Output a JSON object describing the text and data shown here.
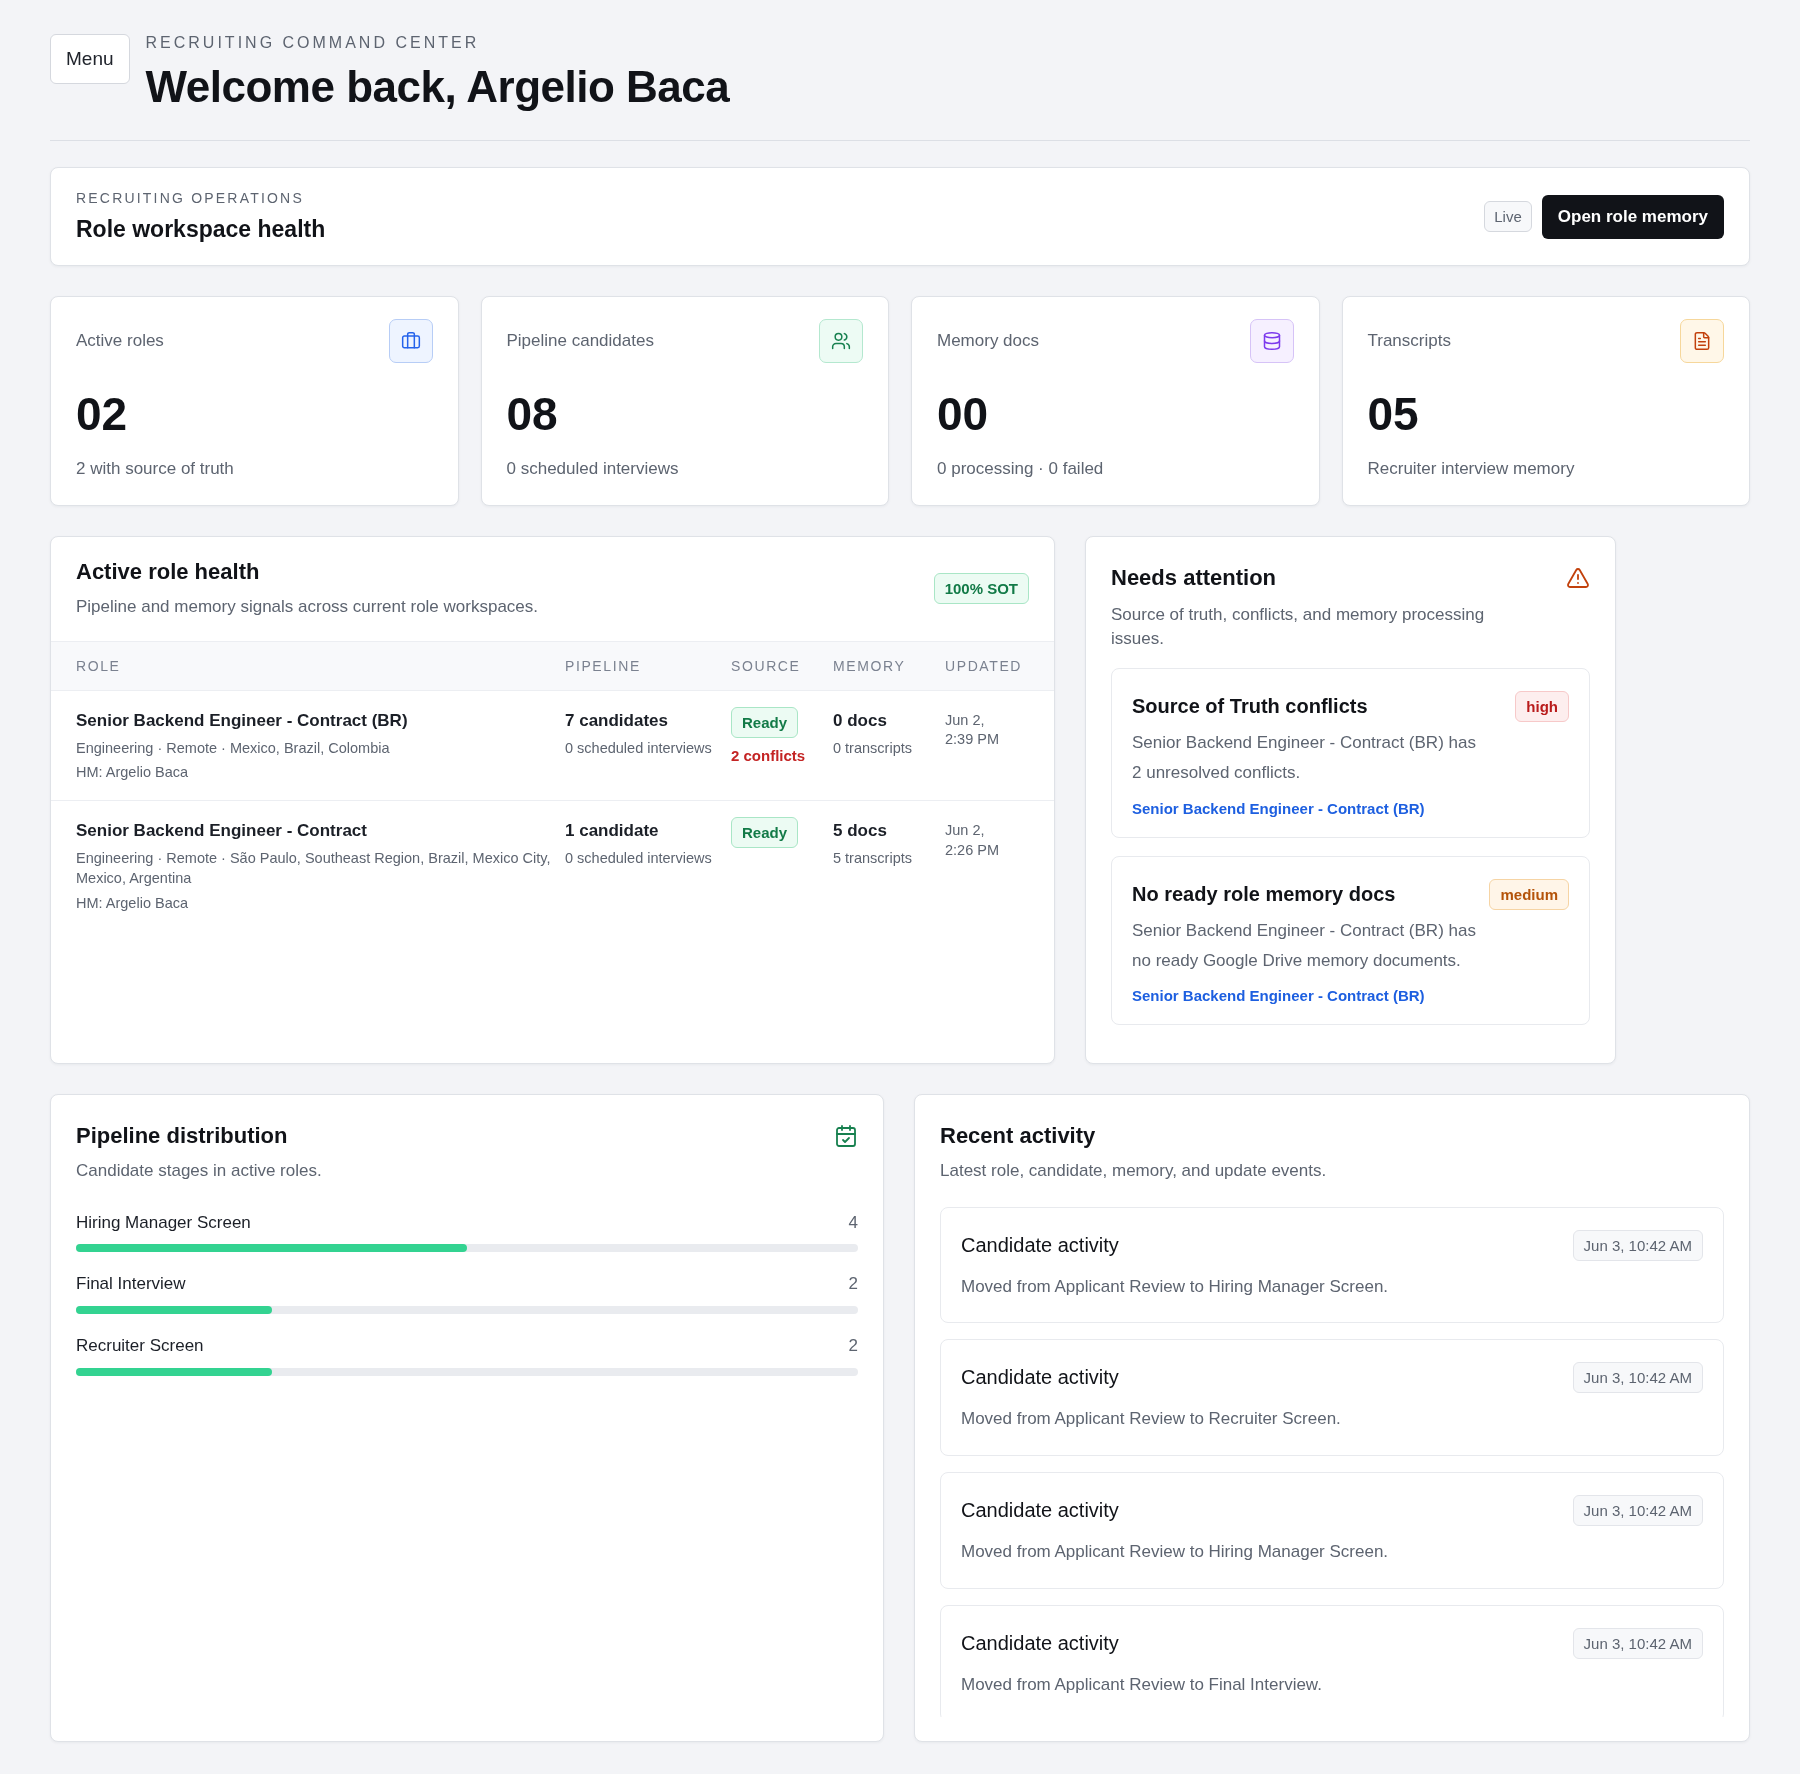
{
  "header": {
    "menu_button": "Menu",
    "eyebrow": "RECRUITING COMMAND CENTER",
    "title": "Welcome back, Argelio Baca"
  },
  "operations": {
    "eyebrow": "RECRUITING OPERATIONS",
    "title": "Role workspace health",
    "status_badge": "Live",
    "action": "Open role memory"
  },
  "stats": [
    {
      "kind": "briefcase",
      "label": "Active roles",
      "value": "02",
      "note": "2 with source of truth"
    },
    {
      "kind": "people",
      "label": "Pipeline candidates",
      "value": "08",
      "note": "0 scheduled interviews"
    },
    {
      "kind": "database",
      "label": "Memory docs",
      "value": "00",
      "note": "0 processing · 0 failed"
    },
    {
      "kind": "document",
      "label": "Transcripts",
      "value": "05",
      "note": "Recruiter interview memory"
    }
  ],
  "role_health": {
    "title": "Active role health",
    "subtitle": "Pipeline and memory signals across current role workspaces.",
    "badge": "100% SOT",
    "columns": [
      "ROLE",
      "PIPELINE",
      "SOURCE",
      "MEMORY",
      "UPDATED"
    ],
    "rows": [
      {
        "role": "Senior Backend Engineer - Contract (BR)",
        "meta": "Engineering · Remote · Mexico, Brazil, Colombia",
        "manager": "HM: Argelio Baca",
        "pipeline": "7 candidates",
        "pipeline_note": "0 scheduled interviews",
        "source": "Ready",
        "source_note": "2 conflicts",
        "memory": "0 docs",
        "memory_note": "0 transcripts",
        "updated": "Jun 2, 2:39 PM"
      },
      {
        "role": "Senior Backend Engineer - Contract",
        "meta": "Engineering · Remote · São Paulo, Southeast Region, Brazil, Mexico City, Mexico, Argentina",
        "manager": "HM: Argelio Baca",
        "pipeline": "1 candidate",
        "pipeline_note": "0 scheduled interviews",
        "source": "Ready",
        "memory": "5 docs",
        "memory_note": "5 transcripts",
        "updated": "Jun 2, 2:26 PM"
      }
    ]
  },
  "attention": {
    "title": "Needs attention",
    "subtitle": "Source of truth, conflicts, and memory processing issues.",
    "items": [
      {
        "title": "Source of Truth conflicts",
        "severity": "high",
        "description": "Senior Backend Engineer - Contract (BR) has 2 unresolved conflicts.",
        "link": "Senior Backend Engineer - Contract (BR)"
      },
      {
        "title": "No ready role memory docs",
        "severity": "medium",
        "description": "Senior Backend Engineer - Contract (BR) has no ready Google Drive memory documents.",
        "link": "Senior Backend Engineer - Contract (BR)"
      }
    ]
  },
  "pipeline_distribution": {
    "title": "Pipeline distribution",
    "subtitle": "Candidate stages in active roles.",
    "stages": [
      {
        "name": "Hiring Manager Screen",
        "count": "4",
        "level": 0.5
      },
      {
        "name": "Final Interview",
        "count": "2",
        "level": 0.25
      },
      {
        "name": "Recruiter Screen",
        "count": "2",
        "level": 0.25
      }
    ]
  },
  "activity": {
    "title": "Recent activity",
    "subtitle": "Latest role, candidate, memory, and update events.",
    "items": [
      {
        "title": "Candidate activity",
        "description": "Moved from Applicant Review to Hiring Manager Screen.",
        "time": "Jun 3, 10:42 AM"
      },
      {
        "title": "Candidate activity",
        "description": "Moved from Applicant Review to Recruiter Screen.",
        "time": "Jun 3, 10:42 AM"
      },
      {
        "title": "Candidate activity",
        "description": "Moved from Applicant Review to Hiring Manager Screen.",
        "time": "Jun 3, 10:42 AM"
      },
      {
        "title": "Candidate activity",
        "description": "Moved from Applicant Review to Final Interview.",
        "time": "Jun 3, 10:42 AM"
      }
    ]
  }
}
